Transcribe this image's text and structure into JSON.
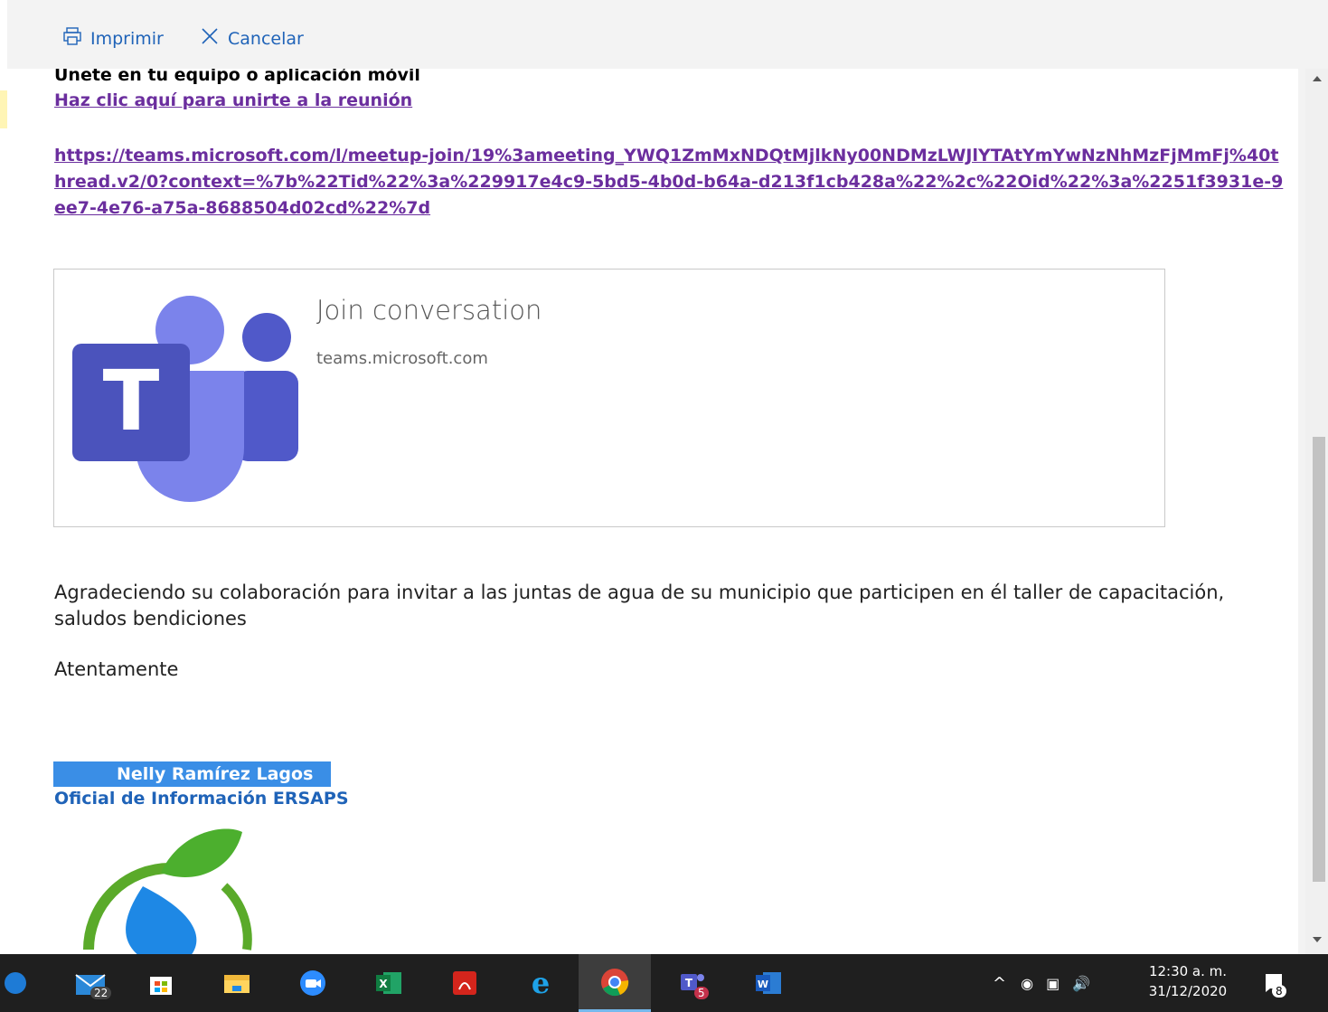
{
  "toolbar": {
    "print_label": "Imprimir",
    "cancel_label": "Cancelar"
  },
  "email": {
    "join_heading": "Unete en tu equipo o aplicación móvil",
    "join_link": "Haz clic aquí para unirte a la reunión",
    "meeting_url": "https://teams.microsoft.com/l/meetup-join/19%3ameeting_YWQ1ZmMxNDQtMjlkNy00NDMzLWJlYTAtYmYwNzNhMzFjMmFj%40thread.v2/0?context=%7b%22Tid%22%3a%229917e4c9-5bd5-4b0d-b64a-d213f1cb428a%22%2c%22Oid%22%3a%2251f3931e-9ee7-4e76-a75a-8688504d02cd%22%7d",
    "card": {
      "title": "Join conversation",
      "domain": "teams.microsoft.com"
    },
    "body_text": "Agradeciendo su colaboración para invitar a las juntas de agua de su municipio que participen en él taller de capacitación, saludos bendiciones",
    "closing": "Atentamente",
    "signature": {
      "name": "Nelly Ramírez Lagos",
      "title": "Oficial de Información ERSAPS"
    }
  },
  "taskbar": {
    "mail_badge": "22",
    "teams_badge": "5",
    "notification_count": "8",
    "time": "12:30 a. m.",
    "date": "31/12/2020"
  },
  "colors": {
    "link": "#6b2e9e",
    "accent": "#1f63b8",
    "signature_bg": "#3a8ee6",
    "teams_purple": "#5059c9"
  }
}
